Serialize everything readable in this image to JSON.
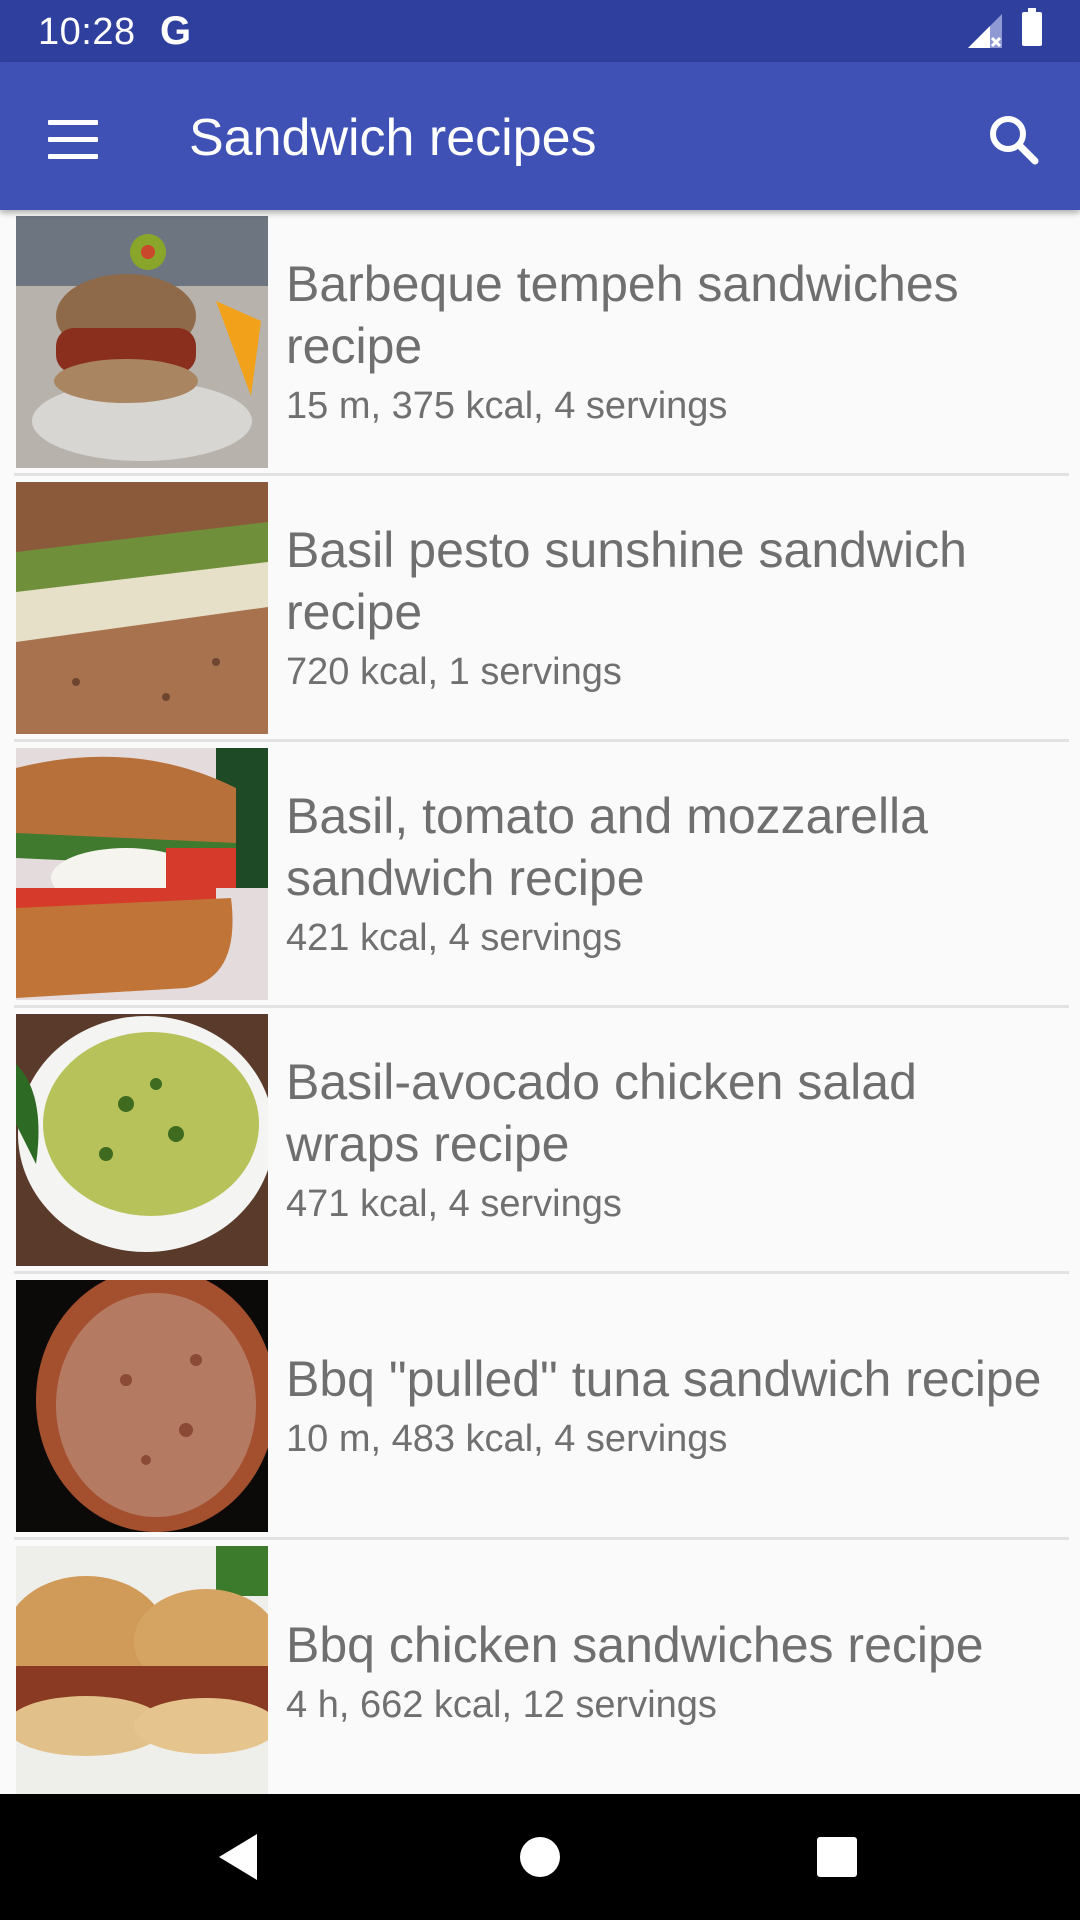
{
  "status_bar": {
    "time": "10:28",
    "g_logo": "G",
    "icons": [
      "signal-icon",
      "battery-icon"
    ]
  },
  "app_bar": {
    "title": "Sandwich recipes",
    "menu_icon": "menu-icon",
    "search_icon": "search-icon",
    "color": "#3f51b5",
    "status_color": "#2f3f9e"
  },
  "recipes": [
    {
      "title": "Barbeque tempeh sandwiches recipe",
      "meta": "15 m, 375 kcal, 4 servings"
    },
    {
      "title": "Basil pesto sunshine sandwich recipe",
      "meta": "720 kcal, 1 servings"
    },
    {
      "title": "Basil, tomato and mozzarella sandwich recipe",
      "meta": "421 kcal, 4 servings"
    },
    {
      "title": "Basil-avocado chicken salad wraps recipe",
      "meta": "471 kcal, 4 servings"
    },
    {
      "title": "Bbq \"pulled\" tuna sandwich recipe",
      "meta": "10 m, 483 kcal, 4 servings"
    },
    {
      "title": "Bbq chicken sandwiches recipe",
      "meta": "4 h, 662 kcal, 12 servings"
    }
  ],
  "nav_bar": {
    "buttons": [
      "back-icon",
      "home-icon",
      "recents-icon"
    ]
  }
}
